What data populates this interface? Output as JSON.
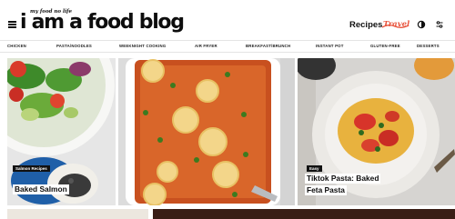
{
  "header": {
    "tagline": "my food no life",
    "brand": "i am a food blog",
    "nav": {
      "recipes": "Recipes",
      "travel": "Travel"
    },
    "icons": [
      "menu-icon",
      "half-moon-theme-icon",
      "search-icon"
    ]
  },
  "categories": [
    "CHICKEN",
    "PASTA/NOODLES",
    "WEEKNIGHT COOKING",
    "AIR FRYER",
    "BREAKFAST/BRUNCH",
    "INSTANT POT",
    "GLUTEN-FREE",
    "DESSERTS"
  ],
  "cards": [
    {
      "badge": "Salmon Recipes",
      "title": "Baked Salmon"
    },
    {
      "badge": "",
      "title": ""
    },
    {
      "badge": "Easy",
      "title_lines": [
        "Tiktok Pasta: Baked",
        "Feta Pasta"
      ]
    }
  ],
  "colors": {
    "accent": "#e8553e",
    "text": "#111111",
    "background": "#ffffff"
  }
}
